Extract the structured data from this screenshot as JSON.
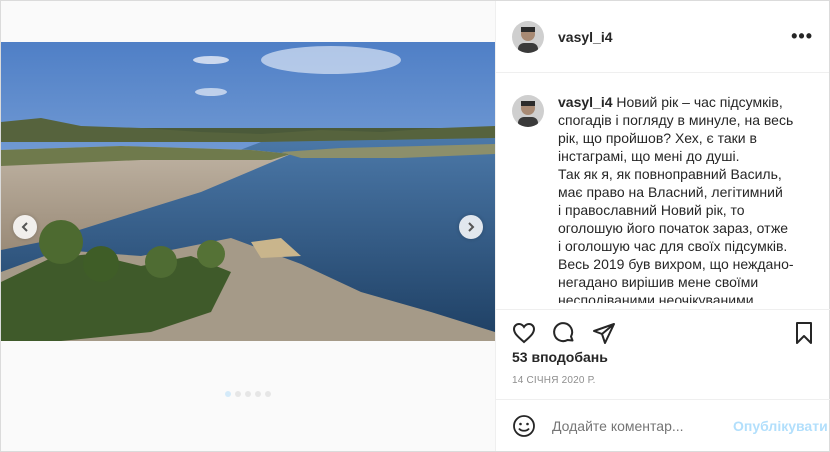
{
  "post": {
    "username": "vasyl_i4",
    "caption_lines": [
      "Новий рік – час підсумків,",
      "спогадів і погляду в минуле, на весь",
      "рік, що пройшов? Хех, є таки в",
      "інстаграмі, що мені до душі.",
      "Так як я, як повноправний Василь,",
      "має право на Власний, легітимний",
      "і православний Новий рік, то",
      "оголошую його початок зараз, отже",
      "і оголошую час для своїх підсумків.",
      "Весь 2019 був вихром, що неждано-",
      "негадано вирішив мене своїми",
      "несподіваними неочікуваними"
    ],
    "likes": "53 вподобань",
    "date": "14 СІЧНЯ 2020 Р."
  },
  "comment": {
    "placeholder": "Додайте коментар...",
    "publish_label": "Опублікувати"
  },
  "carousel": {
    "dot_count": 5,
    "active_index": 0
  },
  "icons": {
    "like": "heart-icon",
    "comment": "comment-icon",
    "share": "share-icon",
    "save": "bookmark-icon",
    "more": "more-options-icon",
    "emoji": "emoji-icon"
  }
}
